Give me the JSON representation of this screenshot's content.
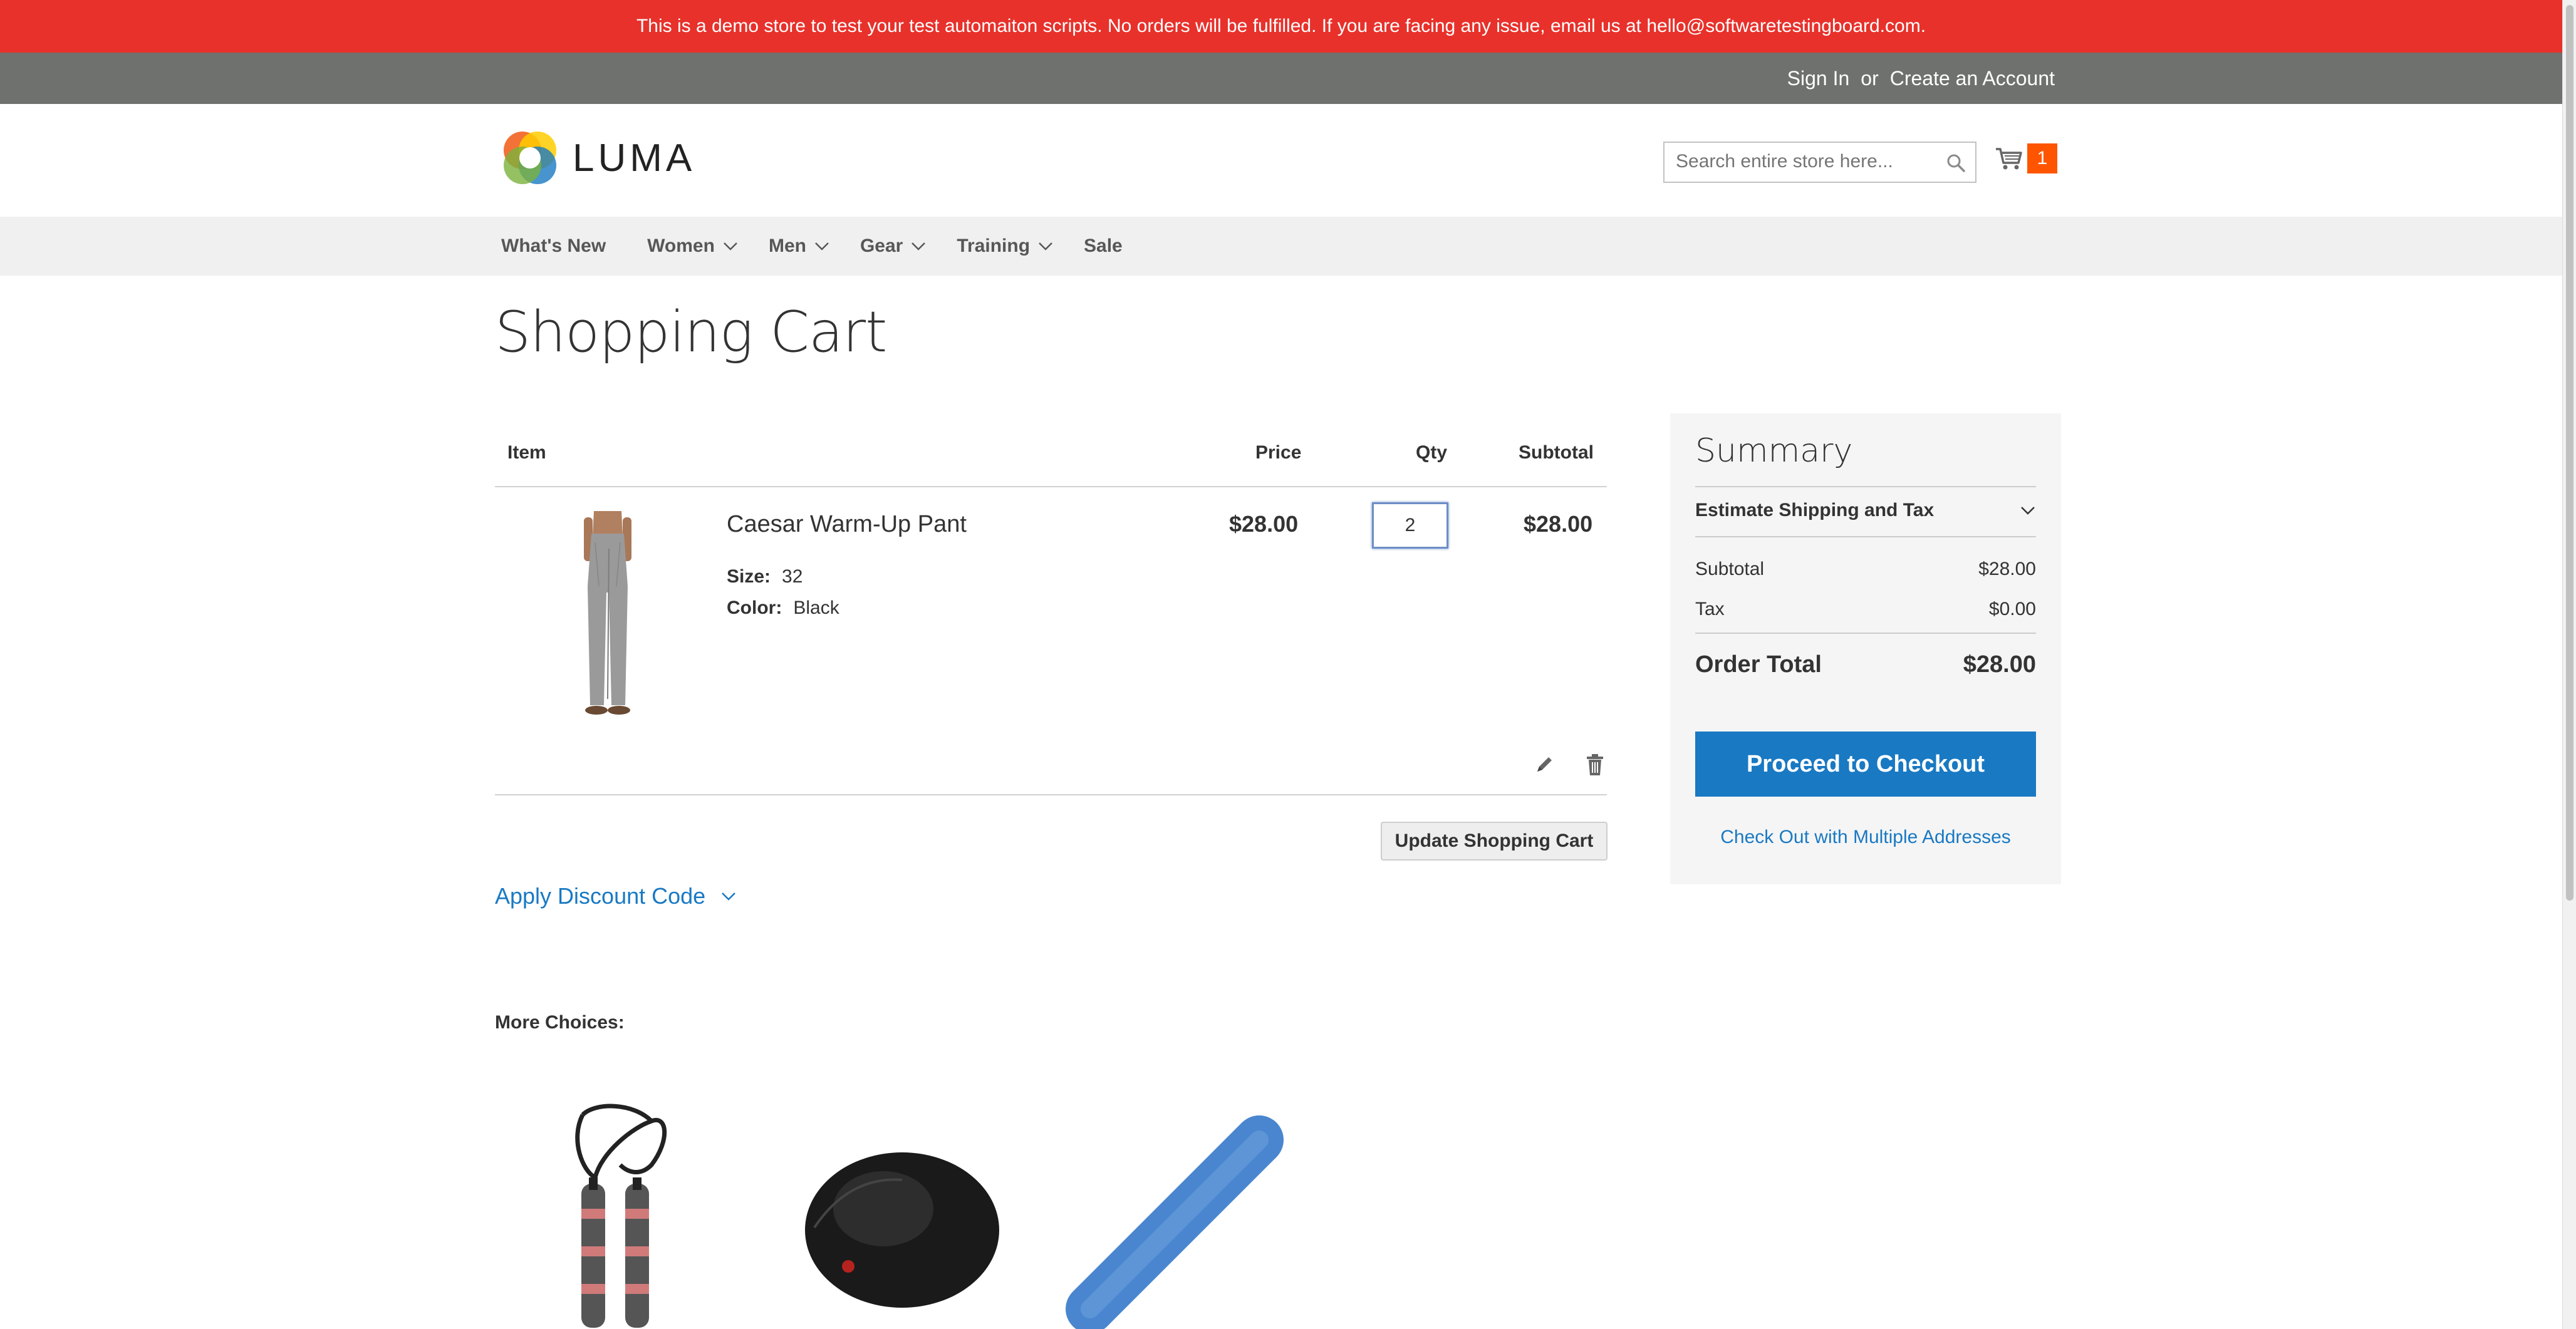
{
  "banner": {
    "text": "This is a demo store to test your test automaiton scripts. No orders will be fulfilled. If you are facing any issue, email us at hello@softwaretestingboard.com."
  },
  "header": {
    "sign_in": "Sign In",
    "or": "or",
    "create_account": "Create an Account"
  },
  "logo": {
    "text": "LUMA"
  },
  "search": {
    "placeholder": "Search entire store here...",
    "icon": "search-icon"
  },
  "minicart": {
    "count": "1",
    "icon": "cart-icon",
    "badge_color": "#ff5501"
  },
  "nav": {
    "items": [
      {
        "label": "What's New",
        "dropdown": false
      },
      {
        "label": "Women",
        "dropdown": true
      },
      {
        "label": "Men",
        "dropdown": true
      },
      {
        "label": "Gear",
        "dropdown": true
      },
      {
        "label": "Training",
        "dropdown": true
      },
      {
        "label": "Sale",
        "dropdown": false
      }
    ]
  },
  "page": {
    "title": "Shopping Cart"
  },
  "cart": {
    "headers": {
      "item": "Item",
      "price": "Price",
      "qty": "Qty",
      "subtotal": "Subtotal"
    },
    "items": [
      {
        "name": "Caesar Warm-Up Pant",
        "options": [
          {
            "label": "Size:",
            "value": "32"
          },
          {
            "label": "Color:",
            "value": "Black"
          }
        ],
        "price": "$28.00",
        "qty": "2",
        "subtotal": "$28.00"
      }
    ],
    "update_label": "Update Shopping Cart",
    "discount_label": "Apply Discount Code"
  },
  "summary": {
    "title": "Summary",
    "estimate_label": "Estimate Shipping and Tax",
    "subtotal_label": "Subtotal",
    "subtotal_value": "$28.00",
    "tax_label": "Tax",
    "tax_value": "$0.00",
    "order_total_label": "Order Total",
    "order_total_value": "$28.00",
    "checkout_label": "Proceed to Checkout",
    "multi_label": "Check Out with Multiple Addresses"
  },
  "more_choices": {
    "title": "More Choices:"
  },
  "colors": {
    "banner": "#e8312b",
    "header": "#6e716e",
    "accent": "#1979c3",
    "nav_bg": "#f0f0f0"
  }
}
